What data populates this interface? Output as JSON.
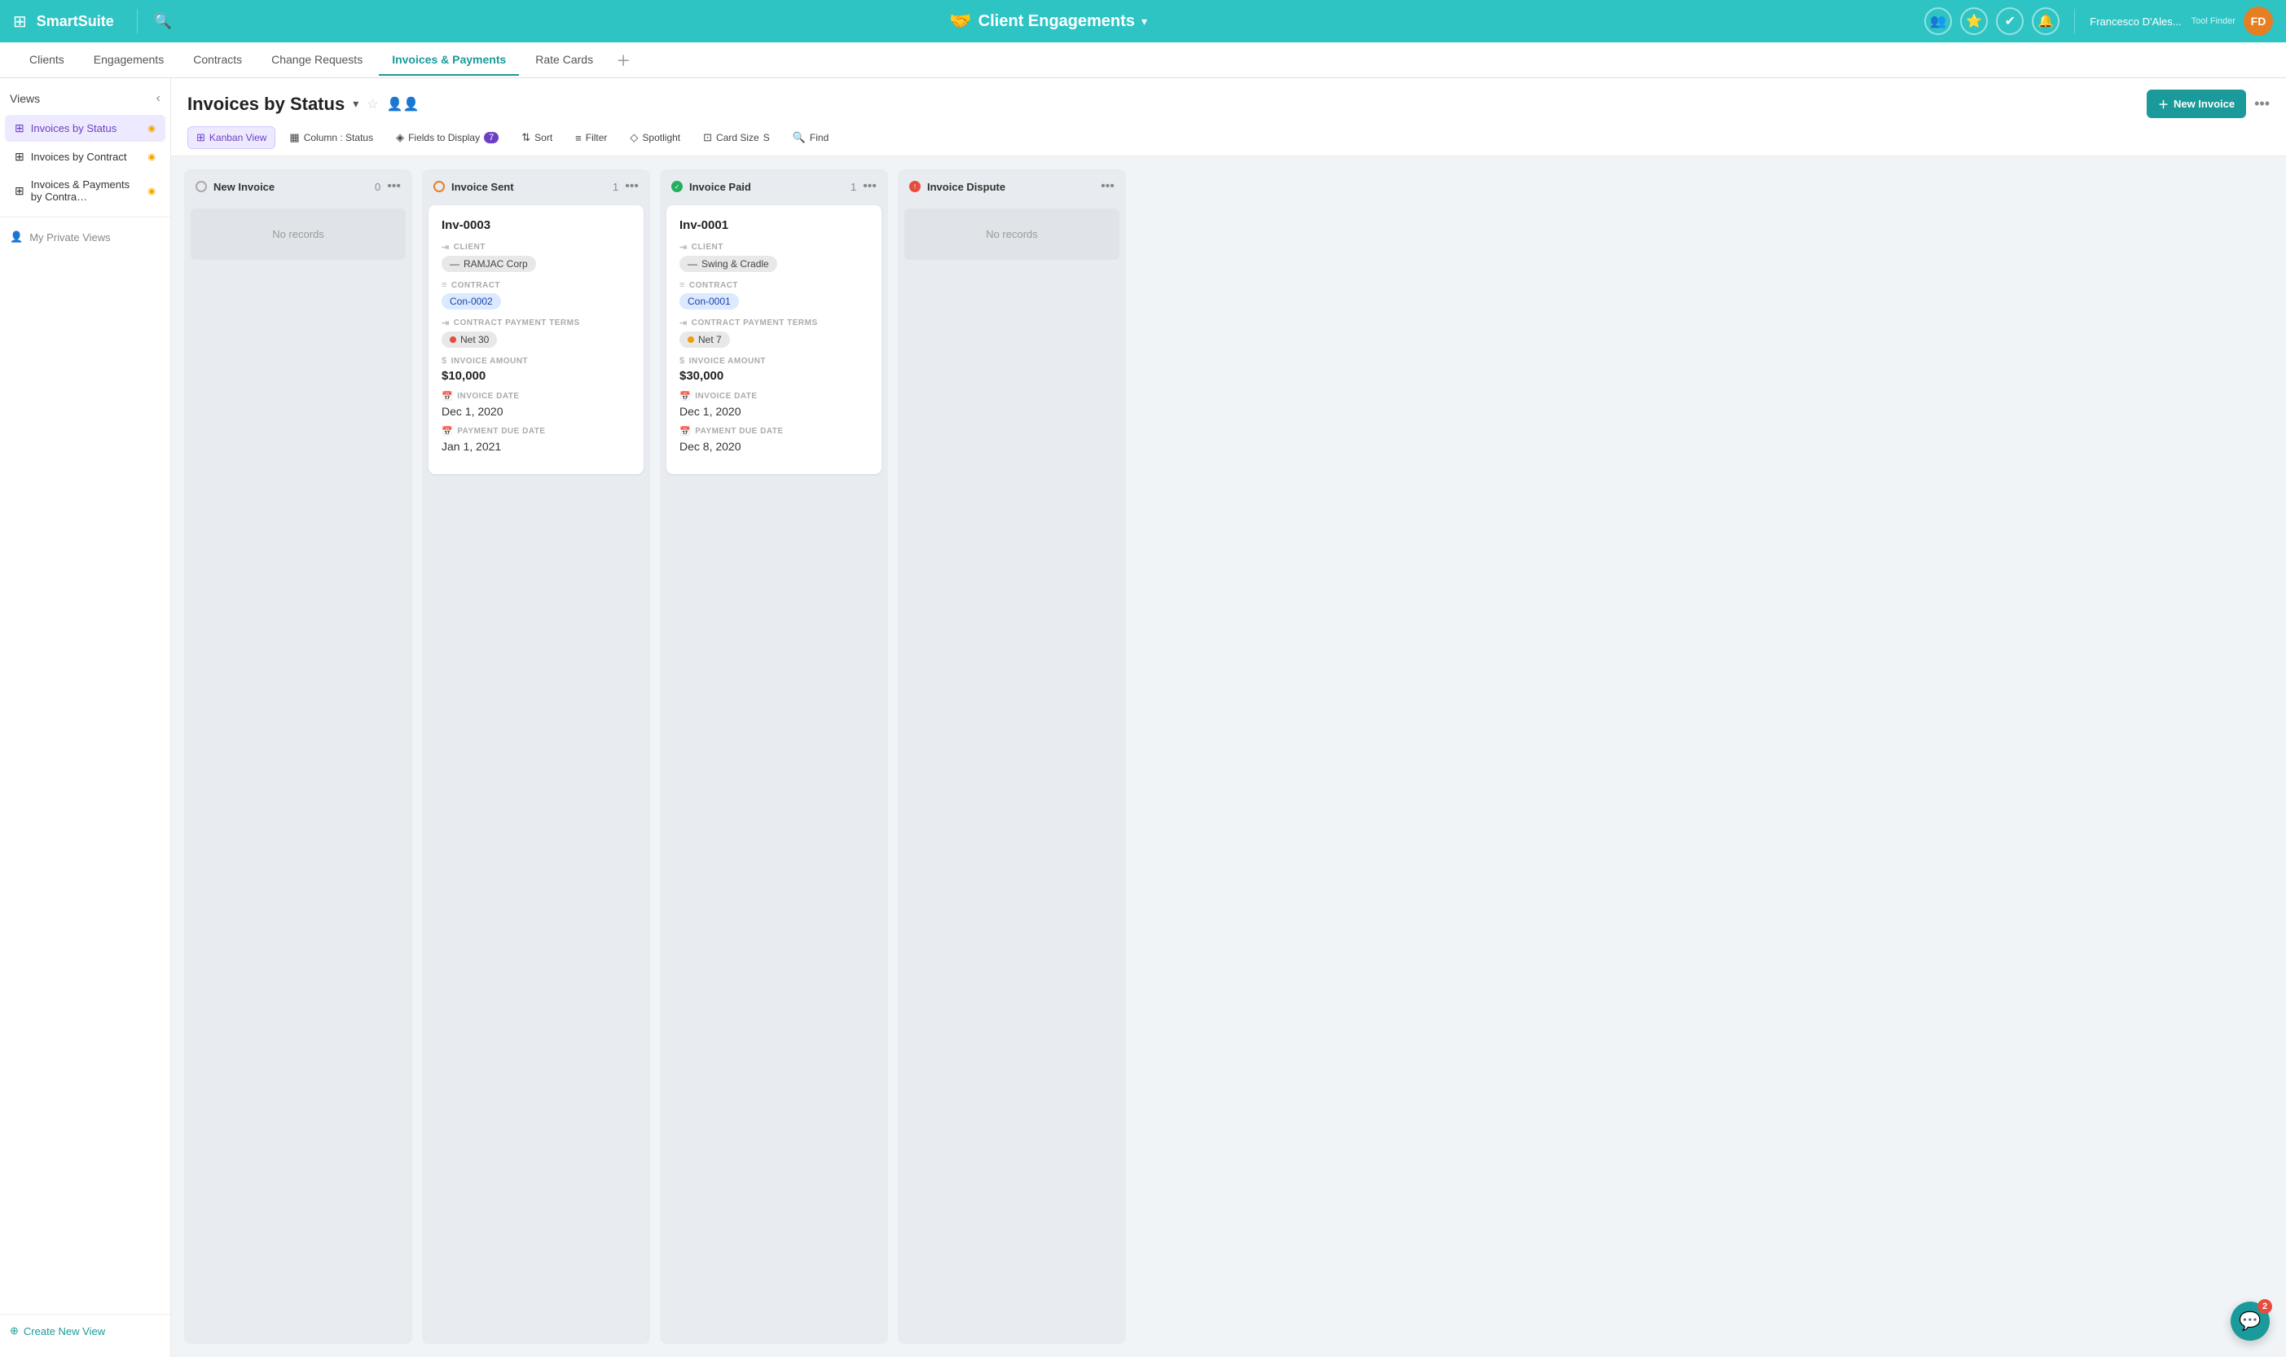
{
  "app": {
    "logo": "SmartSuite",
    "title": "Client Engagements",
    "title_icon": "🤝"
  },
  "header_icons": {
    "team": "👥",
    "star": "⭐",
    "check": "✔",
    "bell": "🔔"
  },
  "user": {
    "name": "Francesco D'Ales...",
    "subtitle": "Tool Finder",
    "initials": "FD"
  },
  "tabs": [
    {
      "label": "Clients",
      "active": false
    },
    {
      "label": "Engagements",
      "active": false
    },
    {
      "label": "Contracts",
      "active": false
    },
    {
      "label": "Change Requests",
      "active": false
    },
    {
      "label": "Invoices & Payments",
      "active": true
    },
    {
      "label": "Rate Cards",
      "active": false
    }
  ],
  "sidebar": {
    "title": "Views",
    "items": [
      {
        "label": "Invoices by Status",
        "active": true,
        "rss": true
      },
      {
        "label": "Invoices by Contract",
        "active": false,
        "rss": true
      },
      {
        "label": "Invoices & Payments by Contra…",
        "active": false,
        "rss": true
      }
    ],
    "private_views_label": "My Private Views",
    "create_view_label": "Create New View"
  },
  "content": {
    "title": "Invoices by Status",
    "new_invoice_label": "New Invoice"
  },
  "toolbar": {
    "kanban_view_label": "Kanban View",
    "column_status_label": "Column : Status",
    "fields_label": "Fields to Display",
    "fields_count": "7",
    "sort_label": "Sort",
    "filter_label": "Filter",
    "spotlight_label": "Spotlight",
    "card_size_label": "Card Size",
    "card_size_value": "S",
    "find_label": "Find"
  },
  "kanban": {
    "columns": [
      {
        "id": "new-invoice",
        "title": "New Invoice",
        "count": 0,
        "status": "new",
        "cards": [],
        "no_records": true
      },
      {
        "id": "invoice-sent",
        "title": "Invoice Sent",
        "count": 1,
        "status": "sent",
        "cards": [
          {
            "id": "Inv-0003",
            "client_label": "CLIENT",
            "client": "RAMJAC Corp",
            "contract_label": "CONTRACT",
            "contract": "Con-0002",
            "payment_terms_label": "CONTRACT PAYMENT TERMS",
            "payment_terms": "Net 30",
            "payment_terms_color": "red",
            "amount_label": "INVOICE AMOUNT",
            "amount": "$10,000",
            "invoice_date_label": "INVOICE DATE",
            "invoice_date": "Dec 1, 2020",
            "due_date_label": "PAYMENT DUE DATE",
            "due_date": "Jan 1, 2021"
          }
        ]
      },
      {
        "id": "invoice-paid",
        "title": "Invoice Paid",
        "count": 1,
        "status": "paid",
        "cards": [
          {
            "id": "Inv-0001",
            "client_label": "CLIENT",
            "client": "Swing & Cradle",
            "contract_label": "CONTRACT",
            "contract": "Con-0001",
            "payment_terms_label": "CONTRACT PAYMENT TERMS",
            "payment_terms": "Net 7",
            "payment_terms_color": "orange",
            "amount_label": "INVOICE AMOUNT",
            "amount": "$30,000",
            "invoice_date_label": "INVOICE DATE",
            "invoice_date": "Dec 1, 2020",
            "due_date_label": "PAYMENT DUE DATE",
            "due_date": "Dec 8, 2020"
          }
        ]
      },
      {
        "id": "invoice-dispute",
        "title": "Invoice Dispute",
        "count": 0,
        "status": "dispute",
        "cards": [],
        "no_records": true
      }
    ]
  },
  "chat": {
    "badge": "2"
  }
}
